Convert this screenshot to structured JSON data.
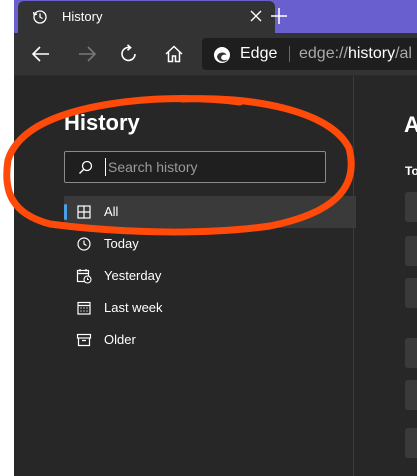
{
  "tab": {
    "title": "History",
    "close_symbol": "✕",
    "new_tab_symbol": "+"
  },
  "addressbar": {
    "brand": "Edge",
    "url_prefix": "edge://",
    "url_highlight": "history",
    "url_suffix": "/al"
  },
  "history": {
    "title": "History",
    "search_placeholder": "Search history",
    "items": [
      {
        "label": "All",
        "icon": "grid-icon",
        "selected": true
      },
      {
        "label": "Today",
        "icon": "clock-icon",
        "selected": false
      },
      {
        "label": "Yesterday",
        "icon": "calendar-clock-icon",
        "selected": false
      },
      {
        "label": "Last week",
        "icon": "calendar-icon",
        "selected": false
      },
      {
        "label": "Older",
        "icon": "archive-icon",
        "selected": false
      }
    ]
  },
  "right_pane": {
    "title": "A",
    "subtitle": "To"
  },
  "colors": {
    "tabstrip": "#6a5fce",
    "accent": "#4aa0e6",
    "annotation": "#ff4a0a"
  }
}
